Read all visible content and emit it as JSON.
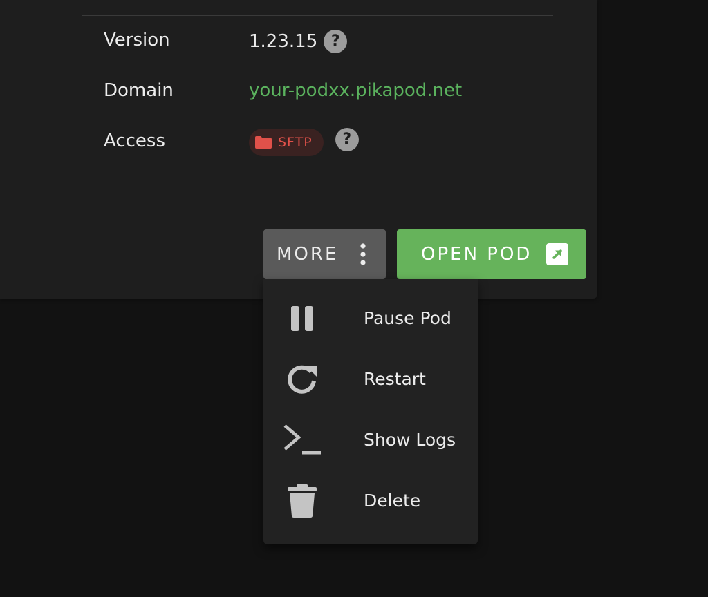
{
  "details": {
    "rows": [
      {
        "label": "Version",
        "value": "1.23.15"
      },
      {
        "label": "Domain",
        "value": "your-podxx.pikapod.net"
      },
      {
        "label": "Access",
        "value": "SFTP"
      }
    ],
    "help_glyph": "?"
  },
  "actions": {
    "more_label": "MORE",
    "open_label": "OPEN POD"
  },
  "menu": {
    "items": [
      {
        "label": "Pause Pod",
        "icon": "pause-icon"
      },
      {
        "label": "Restart",
        "icon": "restart-icon"
      },
      {
        "label": "Show Logs",
        "icon": "terminal-icon"
      },
      {
        "label": "Delete",
        "icon": "trash-icon"
      }
    ]
  },
  "colors": {
    "accent_green": "#66b35b",
    "link_green": "#5bb35e",
    "sftp_red": "#e0514a",
    "card_bg": "#1e1e1e",
    "page_bg": "#121212"
  }
}
